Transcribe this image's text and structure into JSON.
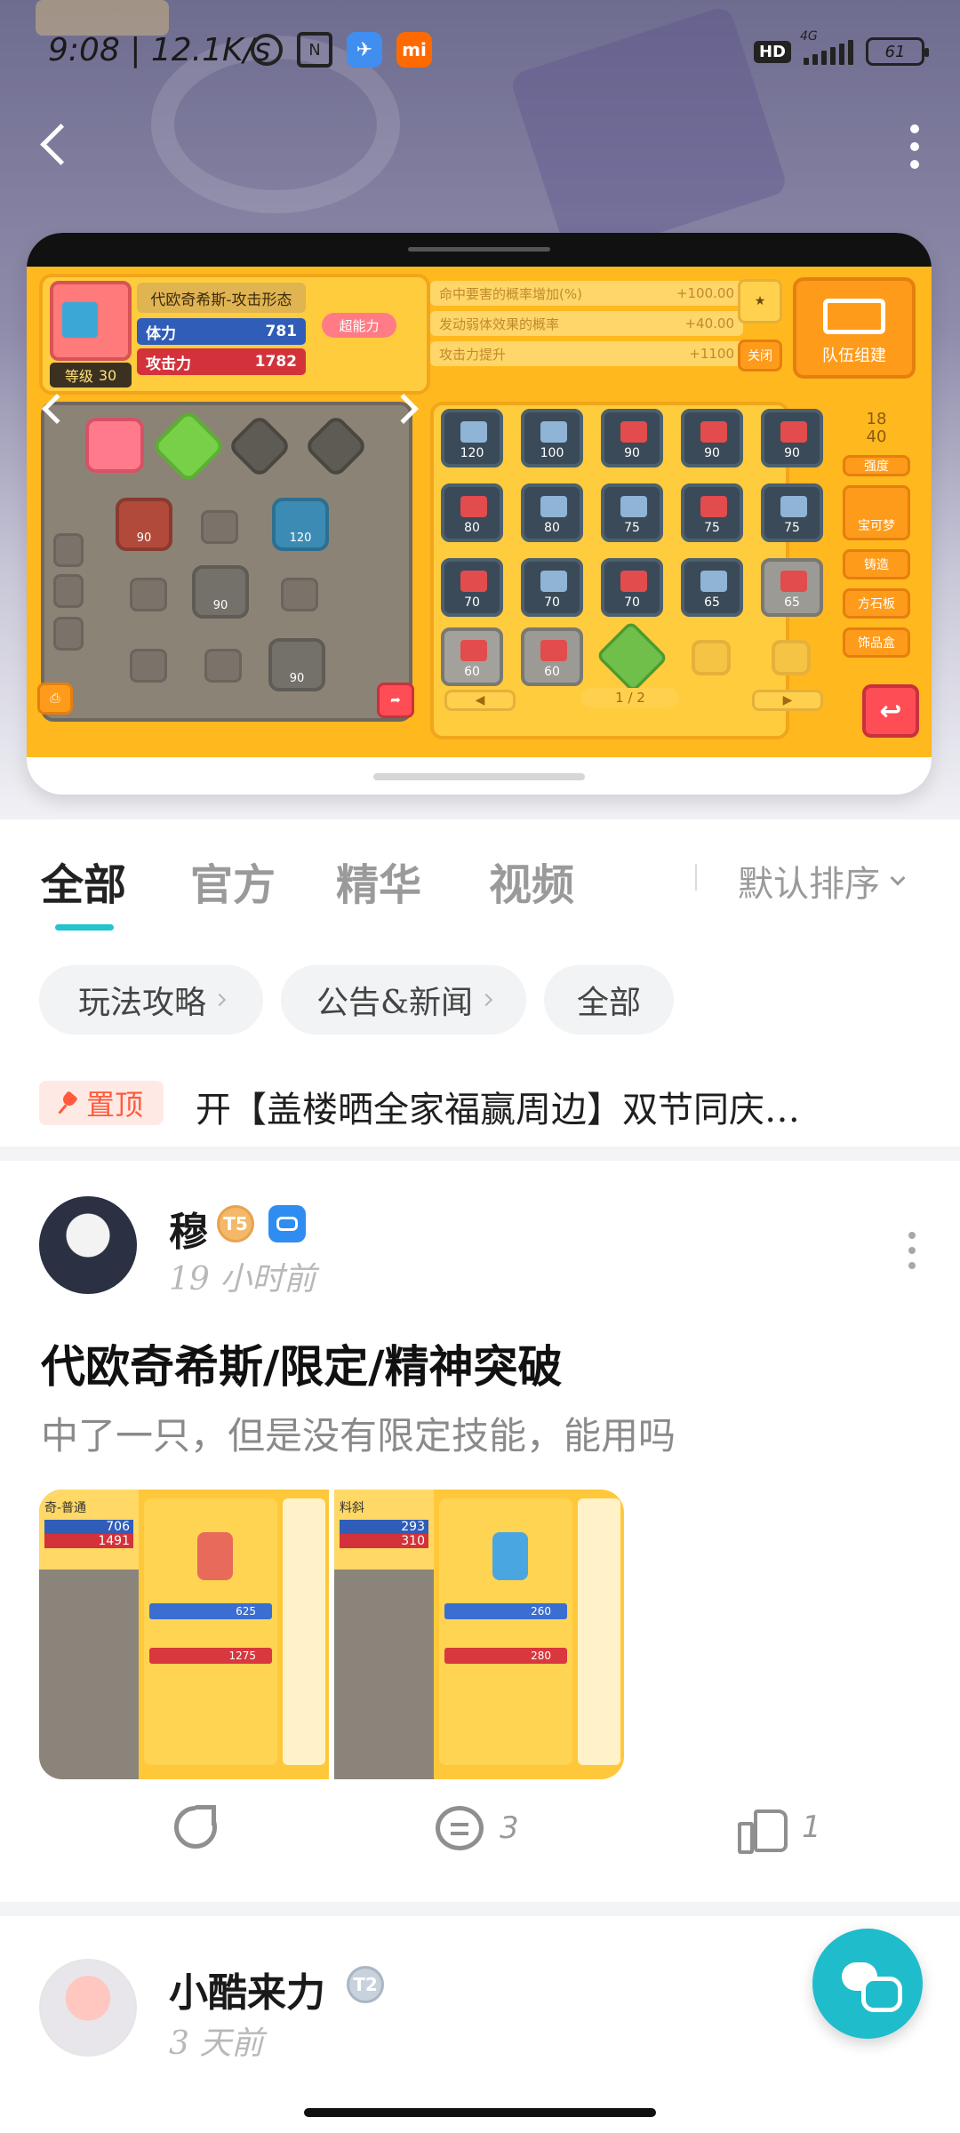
{
  "status_bar": {
    "time": "9:08 | 12.1K/s",
    "network_badge": "HD",
    "signal_label": "4G",
    "battery": "61"
  },
  "header": {
    "back_icon": "chevron-left-icon",
    "more_icon": "more-vertical-icon"
  },
  "game_screenshot": {
    "character_name": "代欧奇希斯-攻击形态",
    "hp_label": "体力",
    "hp_value": "781",
    "atk_label": "攻击力",
    "atk_value": "1782",
    "level_label": "等级",
    "level_value": "30",
    "skill_tag": "超能力",
    "bonuses": [
      {
        "label": "命中要害的概率增加(%)",
        "value": "+100.00"
      },
      {
        "label": "发动弱体效果的概率",
        "value": "+40.00"
      },
      {
        "label": "攻击力提升",
        "value": "+1100"
      }
    ],
    "team_button": "队伍组建",
    "close_button": "关闭",
    "capacity_current": "18",
    "capacity_max": "40",
    "side_buttons": [
      "强度",
      "宝可梦",
      "铸造",
      "方石板",
      "饰品盒"
    ],
    "page_indicator": "1 / 2",
    "inventory_values": [
      "120",
      "100",
      "90",
      "90",
      "90",
      "80",
      "80",
      "75",
      "75",
      "75",
      "70",
      "70",
      "70",
      "65",
      "65",
      "60",
      "60"
    ],
    "board_values": [
      "90",
      "120",
      "90",
      "90"
    ]
  },
  "tabs": {
    "items": [
      "全部",
      "官方",
      "精华",
      "视频"
    ],
    "active": "全部",
    "sort_label": "默认排序"
  },
  "filter_chips": [
    "玩法攻略",
    "公告&新闻",
    "全部"
  ],
  "pinned": {
    "badge": "置顶",
    "text": "开【盖楼晒全家福赢周边】双节同庆…"
  },
  "posts": [
    {
      "username": "穆",
      "level_badge": "T5",
      "time": "19 小时前",
      "title": "代欧奇希斯/限定/精神突破",
      "description": "中了一只，但是没有限定技能，能用吗",
      "thumbs": [
        {
          "name_text": "奇-普通",
          "stat1": "706",
          "stat2": "1491",
          "hp": "625",
          "atk": "1275"
        },
        {
          "name_text": "料斜",
          "stat1": "293",
          "stat2": "310",
          "hp": "260",
          "atk": "280"
        }
      ],
      "comments": "3",
      "likes": "1"
    },
    {
      "username": "小酷来力",
      "level_badge": "T2",
      "time": "3 天前"
    }
  ],
  "colors": {
    "accent": "#23c3cf",
    "pin": "#ff5a3c",
    "game_bg": "#ffb81e"
  }
}
